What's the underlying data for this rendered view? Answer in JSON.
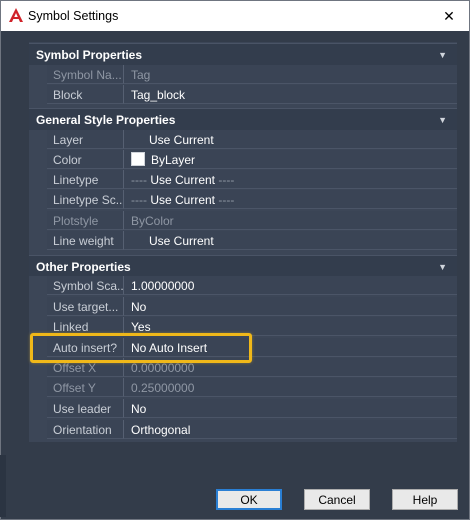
{
  "window": {
    "title": "Symbol Settings",
    "close_glyph": "✕"
  },
  "sections": {
    "symbol": {
      "title": "Symbol Properties",
      "rows": [
        {
          "name": "Symbol Na...",
          "value": "Tag"
        },
        {
          "name": "Block",
          "value": "Tag_block"
        }
      ]
    },
    "general": {
      "title": "General Style Properties",
      "rows": [
        {
          "name": "Layer",
          "value": "Use Current"
        },
        {
          "name": "Color",
          "value": "ByLayer"
        },
        {
          "name": "Linetype",
          "prefix": "----",
          "value": "Use Current",
          "suffix": "----"
        },
        {
          "name": "Linetype Sc...",
          "prefix": "----",
          "value": "Use Current",
          "suffix": "----"
        },
        {
          "name": "Plotstyle",
          "value": "ByColor"
        },
        {
          "name": "Line weight",
          "value": "Use Current"
        }
      ]
    },
    "other": {
      "title": "Other Properties",
      "rows": [
        {
          "name": "Symbol Sca...",
          "value": "1.00000000"
        },
        {
          "name": "Use target...",
          "value": "No"
        },
        {
          "name": "Linked",
          "value": "Yes"
        },
        {
          "name": "Auto insert?",
          "value": "No Auto Insert"
        },
        {
          "name": "Offset X",
          "value": "0.00000000"
        },
        {
          "name": "Offset Y",
          "value": "0.25000000"
        },
        {
          "name": "Use leader",
          "value": "No"
        },
        {
          "name": "Orientation",
          "value": "Orthogonal"
        }
      ]
    }
  },
  "buttons": {
    "ok": "OK",
    "cancel": "Cancel",
    "help": "Help"
  },
  "colors": {
    "highlight": "#f0b819",
    "panel": "#3c4657",
    "accent_app_icon": "#d0232a"
  },
  "icons": {
    "app": "autocad-a-icon",
    "collapse": "chevron-down-icon"
  }
}
